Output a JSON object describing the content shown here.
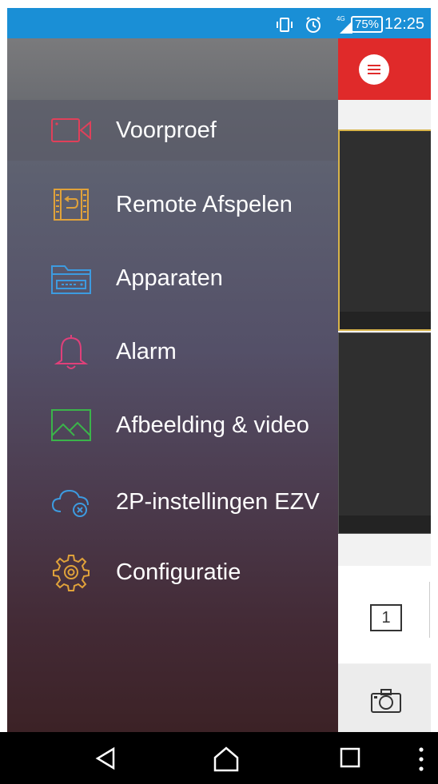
{
  "status_bar": {
    "battery": "75%",
    "time": "12:25",
    "icons": [
      "vibrate-icon",
      "alarm-icon",
      "signal-4g-icon"
    ],
    "network_label": "4G"
  },
  "drawer": {
    "items": [
      {
        "label": "Voorproef",
        "icon": "video-camera-icon",
        "active": true,
        "color": "#e0405a"
      },
      {
        "label": "Remote Afspelen",
        "icon": "film-playback-icon",
        "active": false,
        "color": "#e0a23a"
      },
      {
        "label": "Apparaten",
        "icon": "device-folder-icon",
        "active": false,
        "color": "#3d9be0"
      },
      {
        "label": "Alarm",
        "icon": "bell-icon",
        "active": false,
        "color": "#e0407a"
      },
      {
        "label": "Afbeelding & video",
        "icon": "image-icon",
        "active": false,
        "color": "#3bb44a"
      },
      {
        "label": "2P-instellingen EZV",
        "icon": "cloud-settings-icon",
        "active": false,
        "color": "#3d9be0"
      },
      {
        "label": "Configuratie",
        "icon": "gear-icon",
        "active": false,
        "color": "#e0a23a"
      }
    ]
  },
  "background": {
    "window_split_label": "1"
  },
  "colors": {
    "status_bar": "#1a8fd6",
    "top_bar": "#e02a2a",
    "nav_bar": "#000000"
  }
}
